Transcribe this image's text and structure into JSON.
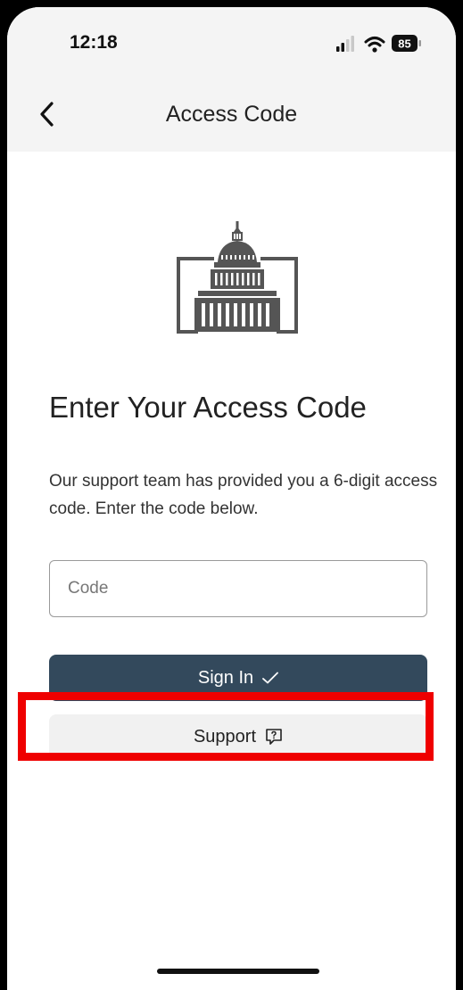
{
  "status_bar": {
    "time": "12:18",
    "battery": "85",
    "icons": [
      "cellular-signal-icon",
      "wifi-icon",
      "battery-icon"
    ]
  },
  "header": {
    "title": "Access Code",
    "back_icon": "chevron-left-icon"
  },
  "logo": {
    "icon": "capitol-building-icon"
  },
  "main": {
    "title": "Enter Your Access Code",
    "description": "Our support team has provided you a 6-digit access code. Enter the code below.",
    "code_field": {
      "placeholder": "Code",
      "value": ""
    },
    "sign_in_label": "Sign In",
    "sign_in_icon": "checkmark-icon",
    "support_label": "Support",
    "support_icon": "help-chat-icon"
  },
  "colors": {
    "primary_button": "#33495c",
    "secondary_button": "#f1f1f1",
    "highlight": "#ef0000",
    "header_bg": "#f4f4f4"
  }
}
